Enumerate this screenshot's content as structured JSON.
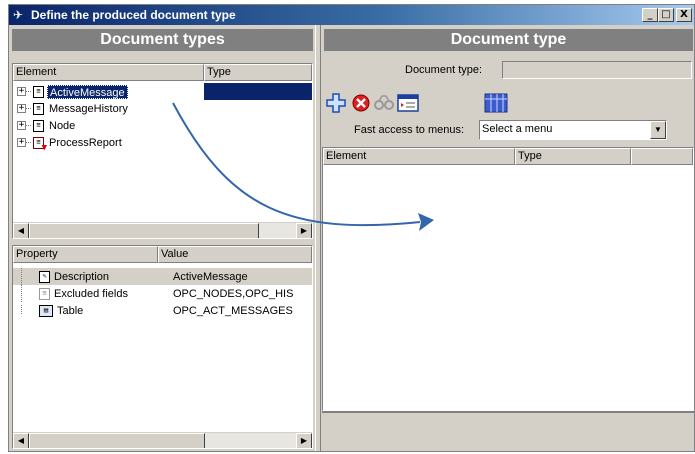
{
  "window": {
    "title": "Define the produced document type"
  },
  "controls": {
    "minimize": "_",
    "maximize": "□",
    "close": "X"
  },
  "left_panel": {
    "header": "Document types",
    "columns": [
      "Element",
      "Type"
    ],
    "tree": [
      {
        "label": "ActiveMessage",
        "selected": true,
        "icon": "document-icon"
      },
      {
        "label": "MessageHistory",
        "selected": false,
        "icon": "document-icon"
      },
      {
        "label": "Node",
        "selected": false,
        "icon": "document-icon"
      },
      {
        "label": "ProcessReport",
        "selected": false,
        "icon": "report-document-icon"
      }
    ],
    "properties_columns": [
      "Property",
      "Value"
    ],
    "properties": [
      {
        "name": "Description",
        "value": "ActiveMessage",
        "icon": "description-icon",
        "selected": true
      },
      {
        "name": "Excluded fields",
        "value": "OPC_NODES,OPC_HIS",
        "icon": "excluded-fields-icon",
        "selected": false
      },
      {
        "name": "Table",
        "value": "OPC_ACT_MESSAGES",
        "icon": "table-icon",
        "selected": false
      }
    ]
  },
  "right_panel": {
    "header": "Document type",
    "document_type_label": "Document type:",
    "document_type_value": "",
    "toolbar": [
      "add-icon",
      "delete-icon",
      "find-icon",
      "edit-form-icon",
      "table-view-icon"
    ],
    "fast_access_label": "Fast access to menus:",
    "fast_access_value": "Select a menu",
    "columns": [
      "Element",
      "Type"
    ]
  },
  "colors": {
    "selection": "#0a246a",
    "header_bg": "#808080",
    "arrow": "#3366aa"
  }
}
